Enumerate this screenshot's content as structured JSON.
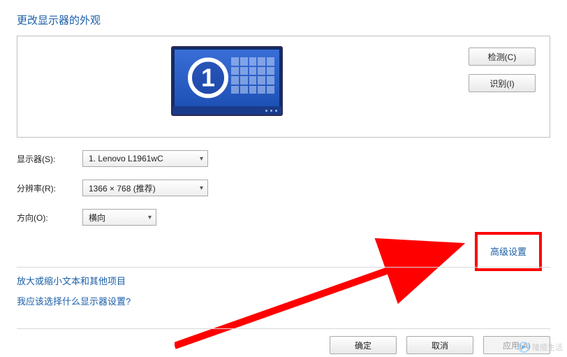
{
  "title": "更改显示器的外观",
  "monitor": {
    "number": "1"
  },
  "panelButtons": {
    "detect": "检测(C)",
    "identify": "识别(I)"
  },
  "form": {
    "displayLabel": "显示器(S):",
    "displayValue": "1. Lenovo L1961wC",
    "resolutionLabel": "分辨率(R):",
    "resolutionValue": "1366 × 768 (推荐)",
    "orientationLabel": "方向(O):",
    "orientationValue": "横向"
  },
  "advancedLink": "高级设置",
  "lowerLinks": {
    "textScaling": "放大或缩小文本和其他项目",
    "whichSettings": "我应该选择什么显示器设置?"
  },
  "bottomButtons": {
    "ok": "确定",
    "cancel": "取消",
    "apply": "应用(A)"
  },
  "watermark": "隆顺生活"
}
